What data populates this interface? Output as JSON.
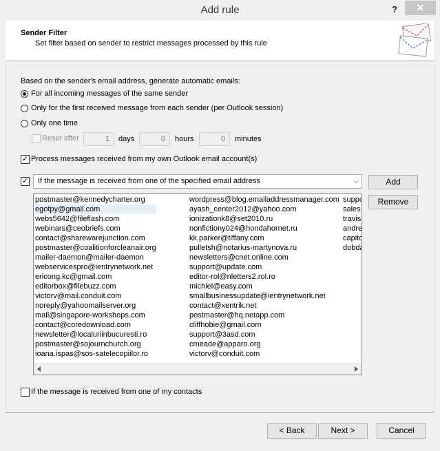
{
  "window": {
    "title": "Add rule",
    "help": "?",
    "close": "✕"
  },
  "header": {
    "title": "Sender Filter",
    "subtitle": "Set filter based on sender to restrict messages processed by this rule"
  },
  "intro": "Based on the sender's email address, generate automatic emails:",
  "radios": [
    {
      "label": "For all incoming messages of the same sender",
      "selected": true
    },
    {
      "label": "Only for the first received message from each sender (per Outlook session)",
      "selected": false
    },
    {
      "label": "Only one time",
      "selected": false
    }
  ],
  "reset": {
    "label": "Reset after",
    "days_value": "1",
    "days_label": "days",
    "hours_value": "0",
    "hours_label": "hours",
    "minutes_value": "0",
    "minutes_label": "minutes"
  },
  "process_own": {
    "label": "Process messages received from my own Outlook email account(s)",
    "checked": true
  },
  "specified": {
    "checked": true,
    "selected_option": "If the message is received from one of the specified email address"
  },
  "buttons": {
    "add": "Add",
    "remove": "Remove"
  },
  "email_columns": [
    [
      "postmaster@kennedycharter.org",
      "egotpy@gmail.com",
      "webs5642@fileflash.com",
      "webinars@ceobriefs.com",
      "contact@sharewarejunction.com",
      "postmaster@coalitionforcleanair.org",
      "mailer-daemon@mailer-daemon",
      "webservicespro@ientrynetwork.net",
      "ericong.kc@gmail.com",
      "editorbox@filebuzz.com",
      "victorv@mail.conduit.com",
      "noreply@yahoomailserver.org",
      "mail@singapore-workshops.com",
      "contact@coredownload.com",
      "newsletter@localuriinbucuresti.ro",
      "postmaster@sojournchurch.org",
      "ioana.ispas@sos-satelecopiilor.ro"
    ],
    [
      "wordpress@blog.emailaddressmanager.com",
      "ayash_center2012@yahoo.com",
      "ionizationk8@set2010.ru",
      "nonfictiony024@hondahornet.ru",
      "kk.parker@tiffany.com",
      "pulletsh@notarius-martynova.ru",
      "newsletters@cnet.online.com",
      "support@update.com",
      "editor-rol@nletters2.rol.ro",
      "michiel@easy.com",
      "smallbusinessupdate@ientrynetwork.net",
      "contact@xentrik.net",
      "postmaster@hq.netapp.com",
      "cliffhobie@gmail.com",
      "support@3asd.com",
      "cmeade@apparo.org",
      "victorv@conduit.com"
    ],
    [
      "suppo",
      "sales",
      "travis",
      "andre",
      "capito",
      "dobda"
    ]
  ],
  "contacts": {
    "label": "If the message is received from one of my contacts",
    "checked": false
  },
  "footer": {
    "back": "< Back",
    "next": "Next >",
    "cancel": "Cancel"
  }
}
